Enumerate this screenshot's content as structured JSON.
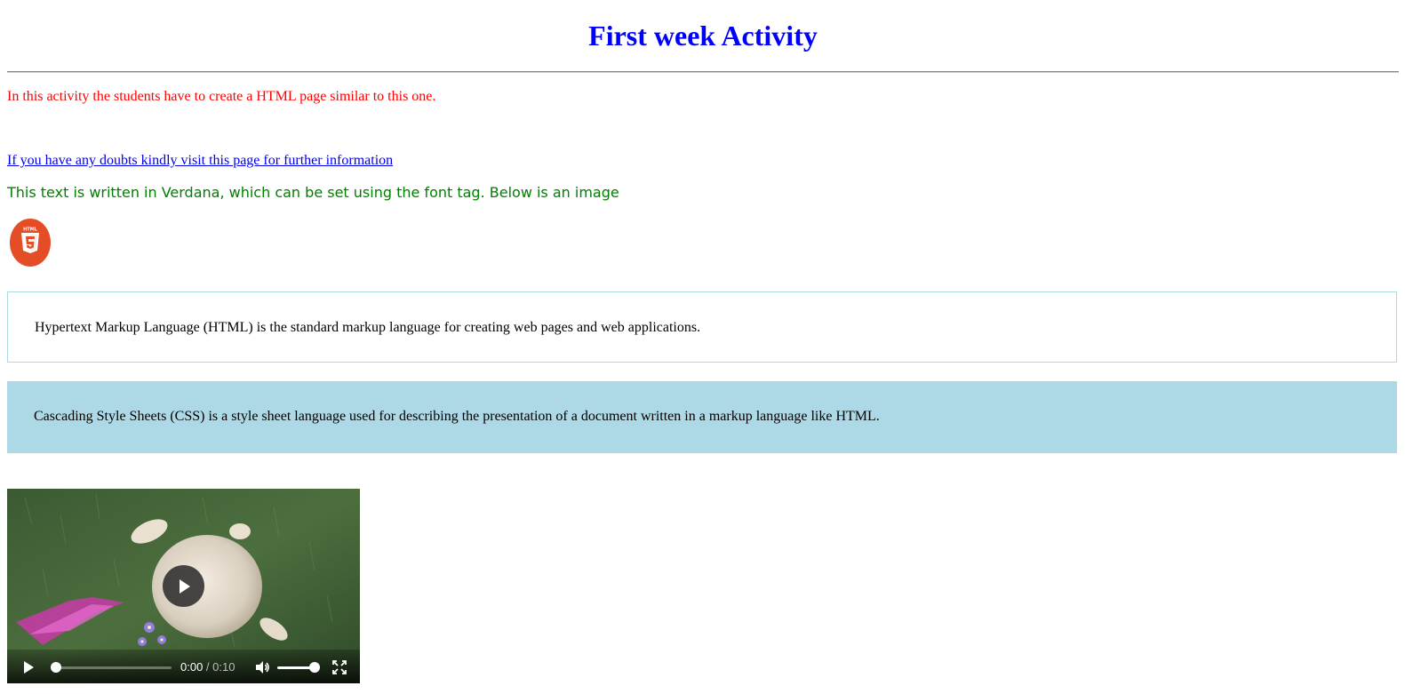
{
  "header": {
    "title": "First week Activity"
  },
  "intro": {
    "text": "In this activity the students have to create a HTML page similar to this one."
  },
  "help_link": {
    "text": "If you have any doubts kindly visit this page for further information"
  },
  "verdana_text": {
    "text": "This text is written in Verdana, which can be set using the font tag. Below is an image"
  },
  "logo": {
    "icon": "html5-logo-icon",
    "label": "HTML",
    "color": "#e44d26"
  },
  "html_box": {
    "text": "Hypertext Markup Language (HTML) is the standard markup language for creating web pages and web applications."
  },
  "css_box": {
    "text": "Cascading Style Sheets (CSS) is a style sheet language used for describing the presentation of a document written in a markup language like HTML.",
    "background": "#add8e6"
  },
  "video": {
    "current_time": "0:00",
    "separator": " / ",
    "duration": "0:10",
    "progress": 0,
    "volume": 1.0,
    "icons": {
      "big_play": "play-icon",
      "play": "play-icon",
      "mute": "volume-icon",
      "fullscreen": "fullscreen-icon"
    }
  },
  "colors": {
    "title": "#0000ff",
    "intro": "#ff0000",
    "link": "#0000ee",
    "verdana": "#008000"
  }
}
